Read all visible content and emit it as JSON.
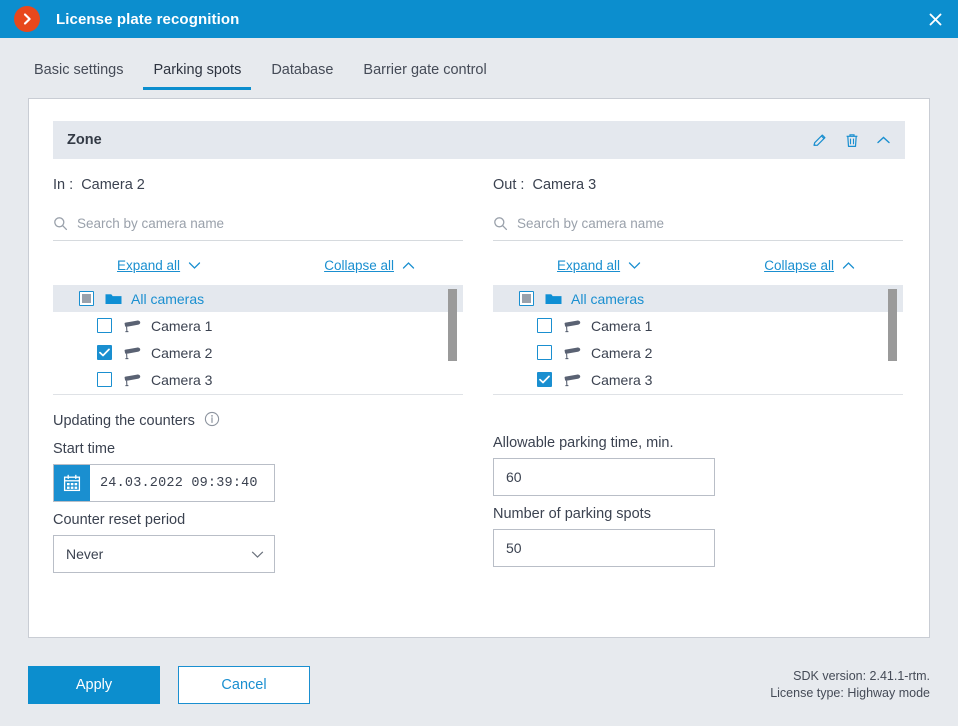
{
  "window": {
    "title": "License plate recognition",
    "logo_icon": "chevron-right-circle-icon",
    "close_icon": "close-icon",
    "titlebar_color": "#0c8ece"
  },
  "tabs": [
    {
      "label": "Basic settings",
      "active": false
    },
    {
      "label": "Parking spots",
      "active": true
    },
    {
      "label": "Database",
      "active": false
    },
    {
      "label": "Barrier gate control",
      "active": false
    }
  ],
  "zone": {
    "title": "Zone",
    "edit_icon": "pencil-icon",
    "delete_icon": "trash-icon",
    "collapse_icon": "chevron-up-icon"
  },
  "in_panel": {
    "label_key": "In :",
    "label_value": "Camera 2",
    "search_placeholder": "Search by camera name",
    "search_value": "",
    "search_icon": "search-icon",
    "expand_all": "Expand all",
    "collapse_all": "Collapse all",
    "tree": [
      {
        "label": "All cameras",
        "icon": "folder-icon",
        "state": "indeterminate",
        "level": 0
      },
      {
        "label": "Camera 1",
        "icon": "camera-icon",
        "state": "unchecked",
        "level": 1
      },
      {
        "label": "Camera 2",
        "icon": "camera-icon",
        "state": "checked",
        "level": 1
      },
      {
        "label": "Camera 3",
        "icon": "camera-icon",
        "state": "unchecked",
        "level": 1
      }
    ]
  },
  "out_panel": {
    "label_key": "Out :",
    "label_value": "Camera 3",
    "search_placeholder": "Search by camera name",
    "search_value": "",
    "search_icon": "search-icon",
    "expand_all": "Expand all",
    "collapse_all": "Collapse all",
    "tree": [
      {
        "label": "All cameras",
        "icon": "folder-icon",
        "state": "indeterminate",
        "level": 0
      },
      {
        "label": "Camera 1",
        "icon": "camera-icon",
        "state": "unchecked",
        "level": 1
      },
      {
        "label": "Camera 2",
        "icon": "camera-icon",
        "state": "unchecked",
        "level": 1
      },
      {
        "label": "Camera 3",
        "icon": "camera-icon",
        "state": "checked",
        "level": 1
      }
    ]
  },
  "form": {
    "section_title": "Updating the counters",
    "info_icon": "info-icon",
    "start_time_label": "Start time",
    "start_time_value": "24.03.2022  09:39:40",
    "calendar_icon": "calendar-icon",
    "reset_period_label": "Counter reset period",
    "reset_period_value": "Never",
    "reset_period_chevron": "chevron-down-icon",
    "allowable_time_label": "Allowable parking time, min.",
    "allowable_time_value": "60",
    "spots_label": "Number of parking spots",
    "spots_value": "50"
  },
  "footer": {
    "apply_label": "Apply",
    "cancel_label": "Cancel",
    "sdk_version": "SDK version: 2.41.1-rtm.",
    "license_type": "License type: Highway mode"
  }
}
